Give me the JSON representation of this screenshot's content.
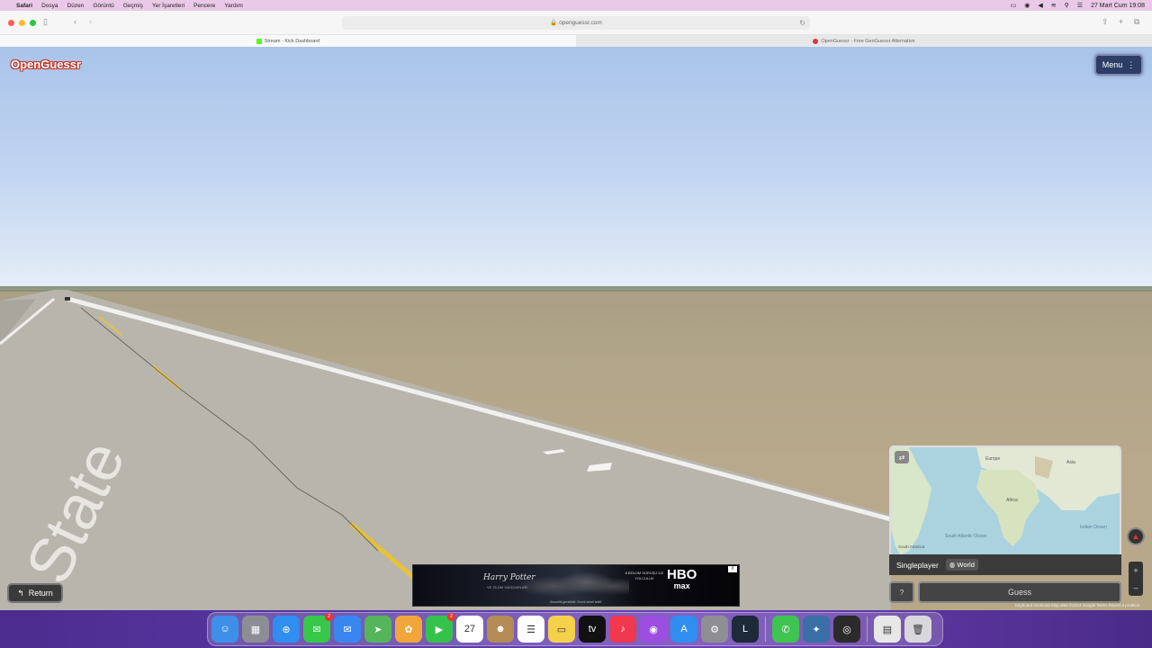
{
  "menubar": {
    "items": [
      "Safari",
      "Dosya",
      "Düzen",
      "Görüntü",
      "Geçmiş",
      "Yer İşaretleri",
      "Pencere",
      "Yardım"
    ],
    "clock": "27 Mart Cum  19:08"
  },
  "browser": {
    "url": "openguessr.com",
    "tabs": [
      {
        "title": "Stream - Kick Dashboard",
        "active": true,
        "favicon_color": "#53fc18"
      },
      {
        "title": "OpenGuessr - Free GeoGuessr Alternative",
        "active": false,
        "favicon_color": "#d9363e"
      }
    ]
  },
  "game": {
    "logo": "OpenGuessr",
    "menu_label": "Menu",
    "return_label": "Return",
    "mode_label": "Singleplayer",
    "map_label": "World",
    "help_label": "?",
    "guess_label": "Guess",
    "map_attribution": "Keyboard shortcuts   Map data ©2024 Google   Terms   Report a problem",
    "minimap_labels": [
      "Europe",
      "Africa",
      "Asia",
      "Indian Ocean",
      "South Atlantic Ocean",
      "South America"
    ]
  },
  "ad": {
    "title": "Harry Potter",
    "subtitle": "VE ÖLÜM YADİGARLARI",
    "middle_text": "8 BÖLÜM SÜRÜŞÜ İLE YOLCULUK",
    "brand": "HBO",
    "brand_sub": "max",
    "close_label": "X",
    "fineprint": "Abonelik gereklidir. Sınırlı süreli teklif."
  },
  "dock": {
    "apps": [
      {
        "name": "finder",
        "color": "#3d8fe8",
        "glyph": "☺"
      },
      {
        "name": "launchpad",
        "color": "#8d8d96",
        "glyph": "▦"
      },
      {
        "name": "safari",
        "color": "#2f8ef0",
        "glyph": "⊕"
      },
      {
        "name": "messages",
        "color": "#37c749",
        "glyph": "✉",
        "badge": "2"
      },
      {
        "name": "mail",
        "color": "#3a86f0",
        "glyph": "✉"
      },
      {
        "name": "maps",
        "color": "#55b55b",
        "glyph": "➤"
      },
      {
        "name": "photos",
        "color": "#f2a53b",
        "glyph": "✿"
      },
      {
        "name": "facetime",
        "color": "#35c24a",
        "glyph": "▶",
        "badge": "2"
      },
      {
        "name": "calendar",
        "color": "#ffffff",
        "glyph": "27"
      },
      {
        "name": "contacts",
        "color": "#b48a55",
        "glyph": "☻"
      },
      {
        "name": "reminders",
        "color": "#ffffff",
        "glyph": "☰"
      },
      {
        "name": "notes",
        "color": "#f5d04a",
        "glyph": "▭"
      },
      {
        "name": "tv",
        "color": "#111111",
        "glyph": "tv"
      },
      {
        "name": "music",
        "color": "#f0384e",
        "glyph": "♪"
      },
      {
        "name": "podcasts",
        "color": "#9b4ee0",
        "glyph": "◉"
      },
      {
        "name": "app-store",
        "color": "#2f8ef0",
        "glyph": "A"
      },
      {
        "name": "system-settings",
        "color": "#8e8e93",
        "glyph": "⚙"
      },
      {
        "name": "league",
        "color": "#1c2a3a",
        "glyph": "L"
      },
      {
        "name": "whatsapp",
        "color": "#3fc452",
        "glyph": "✆"
      },
      {
        "name": "game-app",
        "color": "#3a6fa8",
        "glyph": "✦"
      },
      {
        "name": "obs",
        "color": "#2b2b2b",
        "glyph": "◎"
      },
      {
        "name": "document",
        "color": "#e8e8e8",
        "glyph": "▤"
      },
      {
        "name": "trash",
        "color": "#d8d8dc",
        "glyph": "🗑"
      }
    ]
  }
}
